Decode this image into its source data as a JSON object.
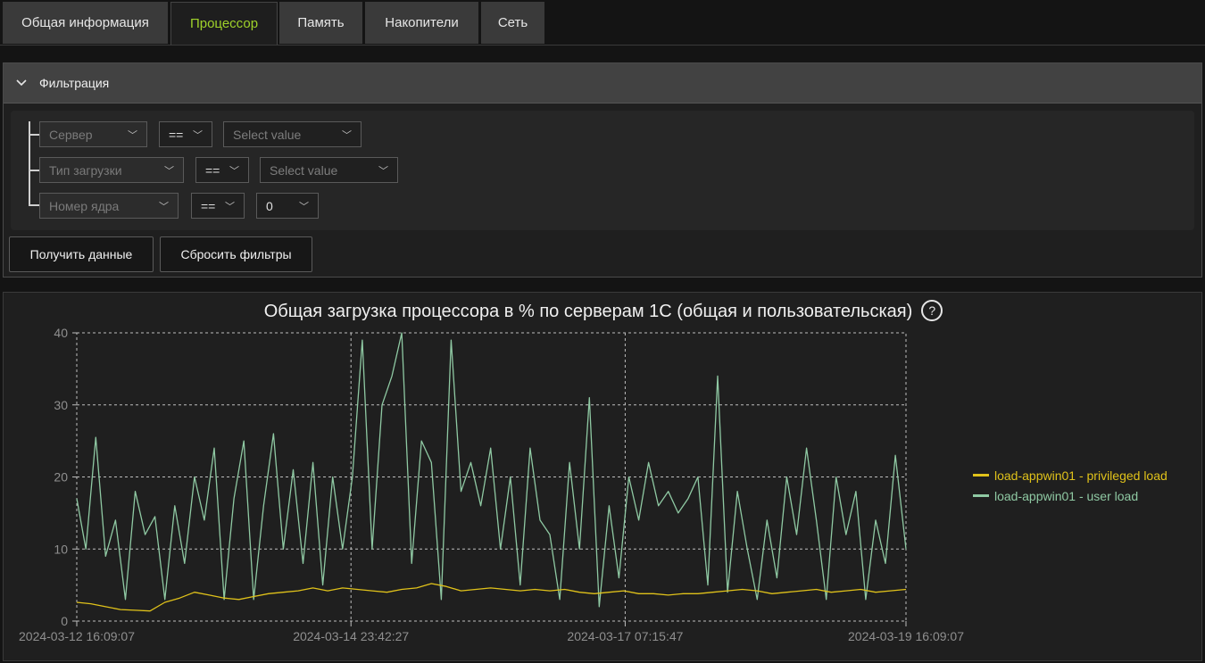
{
  "tabs": [
    {
      "label": "Общая информация"
    },
    {
      "label": "Процессор"
    },
    {
      "label": "Память"
    },
    {
      "label": "Накопители"
    },
    {
      "label": "Сеть"
    }
  ],
  "active_tab": "Процессор",
  "filter": {
    "title": "Фильтрация",
    "rows": [
      {
        "field": "Сервер",
        "op": "==",
        "value": "",
        "placeholder": "Select value"
      },
      {
        "field": "Тип загрузки",
        "op": "==",
        "value": "",
        "placeholder": "Select value"
      },
      {
        "field": "Номер ядра",
        "op": "==",
        "value": "0",
        "placeholder": ""
      }
    ],
    "get_data_label": "Получить данные",
    "reset_label": "Сбросить фильтры"
  },
  "colors": {
    "accent": "#9fd22a",
    "privileged": "#e0c21a",
    "user": "#8fc9a3"
  },
  "chart_data": {
    "type": "line",
    "title": "Общая загрузка процессора в % по серверам 1С (общая и пользовательская)",
    "x_start": "2024-03-12 16:09:07",
    "x_end": "2024-03-19 16:09:07",
    "x_tick_labels": [
      "2024-03-12 16:09:07",
      "2024-03-14 23:42:27",
      "2024-03-17 07:15:47",
      "2024-03-19 16:09:07"
    ],
    "y_ticks": [
      0,
      10,
      20,
      30,
      40
    ],
    "ylim": [
      0,
      40
    ],
    "grid": true,
    "legend_position": "right",
    "series": [
      {
        "name": "load-appwin01 - privileged load",
        "color": "#e0c21a",
        "points": [
          [
            "2024-03-12 16:09:07",
            2.6
          ],
          [
            "2024-03-12 19:00:00",
            2.4
          ],
          [
            "2024-03-12 22:00:00",
            2.0
          ],
          [
            "2024-03-13 01:00:00",
            1.6
          ],
          [
            "2024-03-13 04:00:00",
            1.5
          ],
          [
            "2024-03-13 07:00:00",
            1.4
          ],
          [
            "2024-03-13 10:00:00",
            2.6
          ],
          [
            "2024-03-13 13:00:00",
            3.2
          ],
          [
            "2024-03-13 16:00:00",
            4.0
          ],
          [
            "2024-03-13 19:00:00",
            3.6
          ],
          [
            "2024-03-13 22:00:00",
            3.2
          ],
          [
            "2024-03-14 01:00:00",
            3.0
          ],
          [
            "2024-03-14 04:00:00",
            3.4
          ],
          [
            "2024-03-14 07:00:00",
            3.8
          ],
          [
            "2024-03-14 10:00:00",
            4.0
          ],
          [
            "2024-03-14 13:00:00",
            4.2
          ],
          [
            "2024-03-14 16:00:00",
            4.6
          ],
          [
            "2024-03-14 19:00:00",
            4.2
          ],
          [
            "2024-03-14 22:00:00",
            4.6
          ],
          [
            "2024-03-15 01:00:00",
            4.4
          ],
          [
            "2024-03-15 04:00:00",
            4.2
          ],
          [
            "2024-03-15 07:00:00",
            4.0
          ],
          [
            "2024-03-15 10:00:00",
            4.4
          ],
          [
            "2024-03-15 13:00:00",
            4.6
          ],
          [
            "2024-03-15 16:00:00",
            5.2
          ],
          [
            "2024-03-15 19:00:00",
            4.8
          ],
          [
            "2024-03-15 22:00:00",
            4.2
          ],
          [
            "2024-03-16 01:00:00",
            4.4
          ],
          [
            "2024-03-16 04:00:00",
            4.6
          ],
          [
            "2024-03-16 07:00:00",
            4.4
          ],
          [
            "2024-03-16 10:00:00",
            4.2
          ],
          [
            "2024-03-16 13:00:00",
            4.4
          ],
          [
            "2024-03-16 16:00:00",
            4.2
          ],
          [
            "2024-03-16 19:00:00",
            4.4
          ],
          [
            "2024-03-16 22:00:00",
            4.0
          ],
          [
            "2024-03-17 01:00:00",
            3.8
          ],
          [
            "2024-03-17 04:00:00",
            4.0
          ],
          [
            "2024-03-17 07:00:00",
            4.2
          ],
          [
            "2024-03-17 10:00:00",
            3.8
          ],
          [
            "2024-03-17 13:00:00",
            3.8
          ],
          [
            "2024-03-17 16:00:00",
            3.6
          ],
          [
            "2024-03-17 19:00:00",
            3.8
          ],
          [
            "2024-03-17 22:00:00",
            3.8
          ],
          [
            "2024-03-18 01:00:00",
            4.0
          ],
          [
            "2024-03-18 04:00:00",
            4.2
          ],
          [
            "2024-03-18 07:00:00",
            4.4
          ],
          [
            "2024-03-18 10:00:00",
            4.2
          ],
          [
            "2024-03-18 13:00:00",
            3.8
          ],
          [
            "2024-03-18 16:00:00",
            4.0
          ],
          [
            "2024-03-18 19:00:00",
            4.2
          ],
          [
            "2024-03-18 22:00:00",
            4.4
          ],
          [
            "2024-03-19 01:00:00",
            4.0
          ],
          [
            "2024-03-19 04:00:00",
            4.2
          ],
          [
            "2024-03-19 07:00:00",
            4.4
          ],
          [
            "2024-03-19 10:00:00",
            4.0
          ],
          [
            "2024-03-19 13:00:00",
            4.2
          ],
          [
            "2024-03-19 16:09:07",
            4.4
          ]
        ]
      },
      {
        "name": "load-appwin01 - user load",
        "color": "#8fc9a3",
        "points": [
          [
            "2024-03-12 16:09:07",
            17.0
          ],
          [
            "2024-03-12 18:00:00",
            10.0
          ],
          [
            "2024-03-12 20:00:00",
            25.5
          ],
          [
            "2024-03-12 22:00:00",
            9.0
          ],
          [
            "2024-03-13 00:00:00",
            14.0
          ],
          [
            "2024-03-13 02:00:00",
            3.0
          ],
          [
            "2024-03-13 04:00:00",
            18.0
          ],
          [
            "2024-03-13 06:00:00",
            12.0
          ],
          [
            "2024-03-13 08:00:00",
            14.5
          ],
          [
            "2024-03-13 10:00:00",
            3.0
          ],
          [
            "2024-03-13 12:00:00",
            16.0
          ],
          [
            "2024-03-13 14:00:00",
            8.0
          ],
          [
            "2024-03-13 16:00:00",
            20.0
          ],
          [
            "2024-03-13 18:00:00",
            14.0
          ],
          [
            "2024-03-13 20:00:00",
            24.0
          ],
          [
            "2024-03-13 22:00:00",
            3.0
          ],
          [
            "2024-03-14 00:00:00",
            17.0
          ],
          [
            "2024-03-14 02:00:00",
            25.0
          ],
          [
            "2024-03-14 04:00:00",
            3.0
          ],
          [
            "2024-03-14 06:00:00",
            16.0
          ],
          [
            "2024-03-14 08:00:00",
            26.0
          ],
          [
            "2024-03-14 10:00:00",
            10.0
          ],
          [
            "2024-03-14 12:00:00",
            21.0
          ],
          [
            "2024-03-14 14:00:00",
            8.0
          ],
          [
            "2024-03-14 16:00:00",
            22.0
          ],
          [
            "2024-03-14 18:00:00",
            5.0
          ],
          [
            "2024-03-14 20:00:00",
            20.0
          ],
          [
            "2024-03-14 22:00:00",
            10.0
          ],
          [
            "2024-03-15 00:00:00",
            20.0
          ],
          [
            "2024-03-15 02:00:00",
            39.0
          ],
          [
            "2024-03-15 04:00:00",
            10.0
          ],
          [
            "2024-03-15 06:00:00",
            30.0
          ],
          [
            "2024-03-15 08:00:00",
            34.0
          ],
          [
            "2024-03-15 10:00:00",
            40.0
          ],
          [
            "2024-03-15 12:00:00",
            8.0
          ],
          [
            "2024-03-15 14:00:00",
            25.0
          ],
          [
            "2024-03-15 16:00:00",
            22.0
          ],
          [
            "2024-03-15 18:00:00",
            3.0
          ],
          [
            "2024-03-15 20:00:00",
            39.0
          ],
          [
            "2024-03-15 22:00:00",
            18.0
          ],
          [
            "2024-03-16 00:00:00",
            22.0
          ],
          [
            "2024-03-16 02:00:00",
            16.0
          ],
          [
            "2024-03-16 04:00:00",
            24.0
          ],
          [
            "2024-03-16 06:00:00",
            10.0
          ],
          [
            "2024-03-16 08:00:00",
            20.0
          ],
          [
            "2024-03-16 10:00:00",
            5.0
          ],
          [
            "2024-03-16 12:00:00",
            24.0
          ],
          [
            "2024-03-16 14:00:00",
            14.0
          ],
          [
            "2024-03-16 16:00:00",
            12.0
          ],
          [
            "2024-03-16 18:00:00",
            3.0
          ],
          [
            "2024-03-16 20:00:00",
            22.0
          ],
          [
            "2024-03-16 22:00:00",
            10.0
          ],
          [
            "2024-03-17 00:00:00",
            31.0
          ],
          [
            "2024-03-17 02:00:00",
            2.0
          ],
          [
            "2024-03-17 04:00:00",
            16.0
          ],
          [
            "2024-03-17 06:00:00",
            6.0
          ],
          [
            "2024-03-17 08:00:00",
            20.0
          ],
          [
            "2024-03-17 10:00:00",
            14.0
          ],
          [
            "2024-03-17 12:00:00",
            22.0
          ],
          [
            "2024-03-17 14:00:00",
            16.0
          ],
          [
            "2024-03-17 16:00:00",
            18.0
          ],
          [
            "2024-03-17 18:00:00",
            15.0
          ],
          [
            "2024-03-17 20:00:00",
            17.0
          ],
          [
            "2024-03-17 22:00:00",
            20.0
          ],
          [
            "2024-03-18 00:00:00",
            5.0
          ],
          [
            "2024-03-18 02:00:00",
            34.0
          ],
          [
            "2024-03-18 04:00:00",
            4.0
          ],
          [
            "2024-03-18 06:00:00",
            18.0
          ],
          [
            "2024-03-18 08:00:00",
            10.0
          ],
          [
            "2024-03-18 10:00:00",
            3.0
          ],
          [
            "2024-03-18 12:00:00",
            14.0
          ],
          [
            "2024-03-18 14:00:00",
            6.0
          ],
          [
            "2024-03-18 16:00:00",
            20.0
          ],
          [
            "2024-03-18 18:00:00",
            12.0
          ],
          [
            "2024-03-18 20:00:00",
            24.0
          ],
          [
            "2024-03-18 22:00:00",
            14.0
          ],
          [
            "2024-03-19 00:00:00",
            3.0
          ],
          [
            "2024-03-19 02:00:00",
            20.0
          ],
          [
            "2024-03-19 04:00:00",
            12.0
          ],
          [
            "2024-03-19 06:00:00",
            18.0
          ],
          [
            "2024-03-19 08:00:00",
            3.0
          ],
          [
            "2024-03-19 10:00:00",
            14.0
          ],
          [
            "2024-03-19 12:00:00",
            8.0
          ],
          [
            "2024-03-19 14:00:00",
            23.0
          ],
          [
            "2024-03-19 16:09:07",
            10.0
          ]
        ]
      }
    ]
  }
}
